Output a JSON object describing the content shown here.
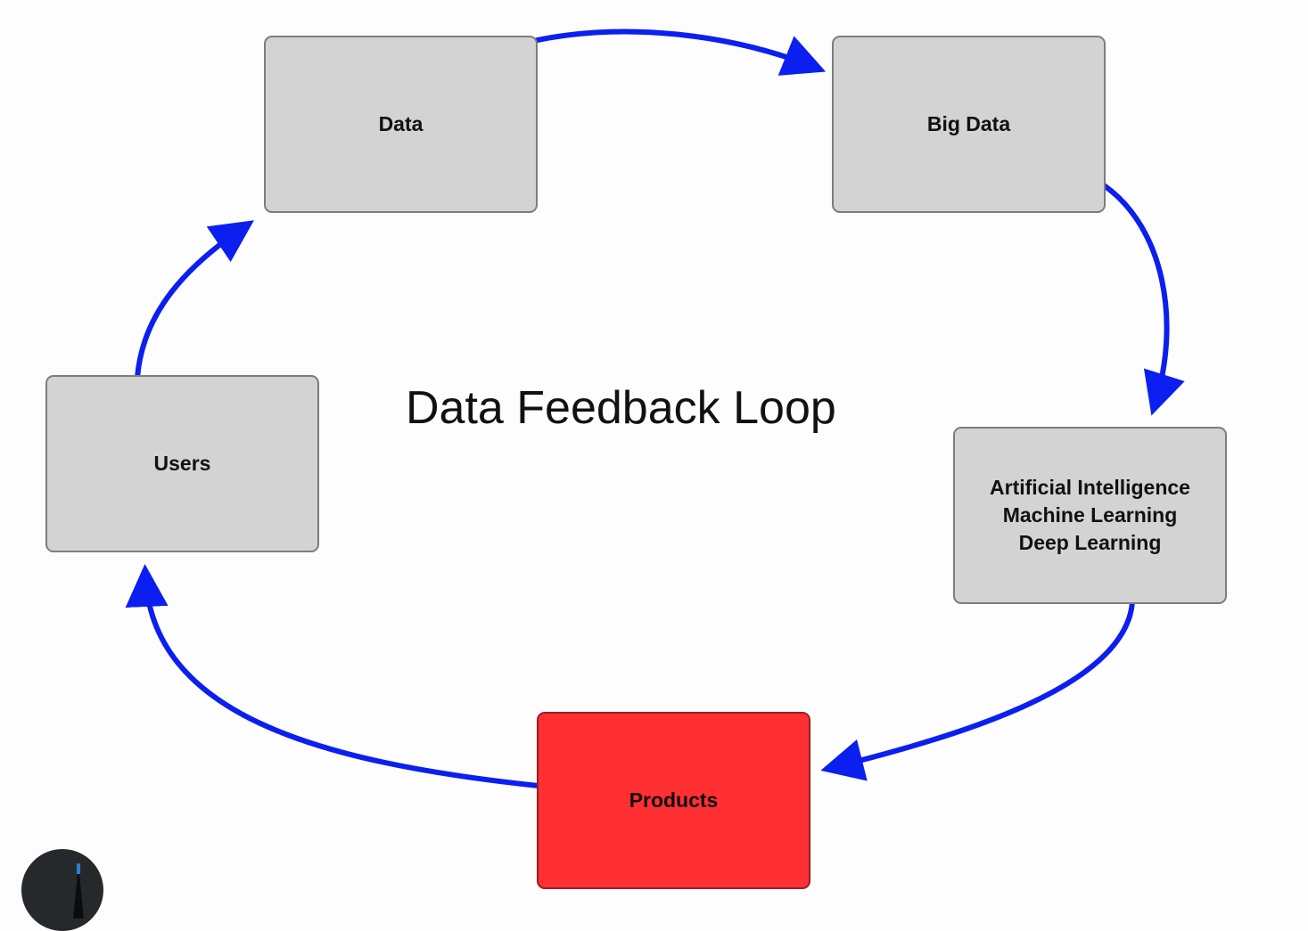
{
  "diagram": {
    "title": "Data Feedback Loop",
    "nodes": {
      "data": {
        "label": "Data"
      },
      "big_data": {
        "label": "Big Data"
      },
      "ai": {
        "lines": [
          "Artificial Intelligence",
          "Machine Learning",
          "Deep Learning"
        ]
      },
      "products": {
        "label": "Products"
      },
      "users": {
        "label": "Users"
      }
    },
    "edges": [
      {
        "from": "Data",
        "to": "Big Data"
      },
      {
        "from": "Big Data",
        "to": "Artificial Intelligence / Machine Learning / Deep Learning"
      },
      {
        "from": "Artificial Intelligence / Machine Learning / Deep Learning",
        "to": "Products"
      },
      {
        "from": "Products",
        "to": "Users"
      },
      {
        "from": "Users",
        "to": "Data"
      }
    ],
    "colors": {
      "node_fill": "#d3d3d3",
      "highlight_fill": "#fe3033",
      "arrow": "#0b1ff0"
    }
  },
  "overlay": {
    "avatar_icon": "pen-avatar-icon"
  }
}
